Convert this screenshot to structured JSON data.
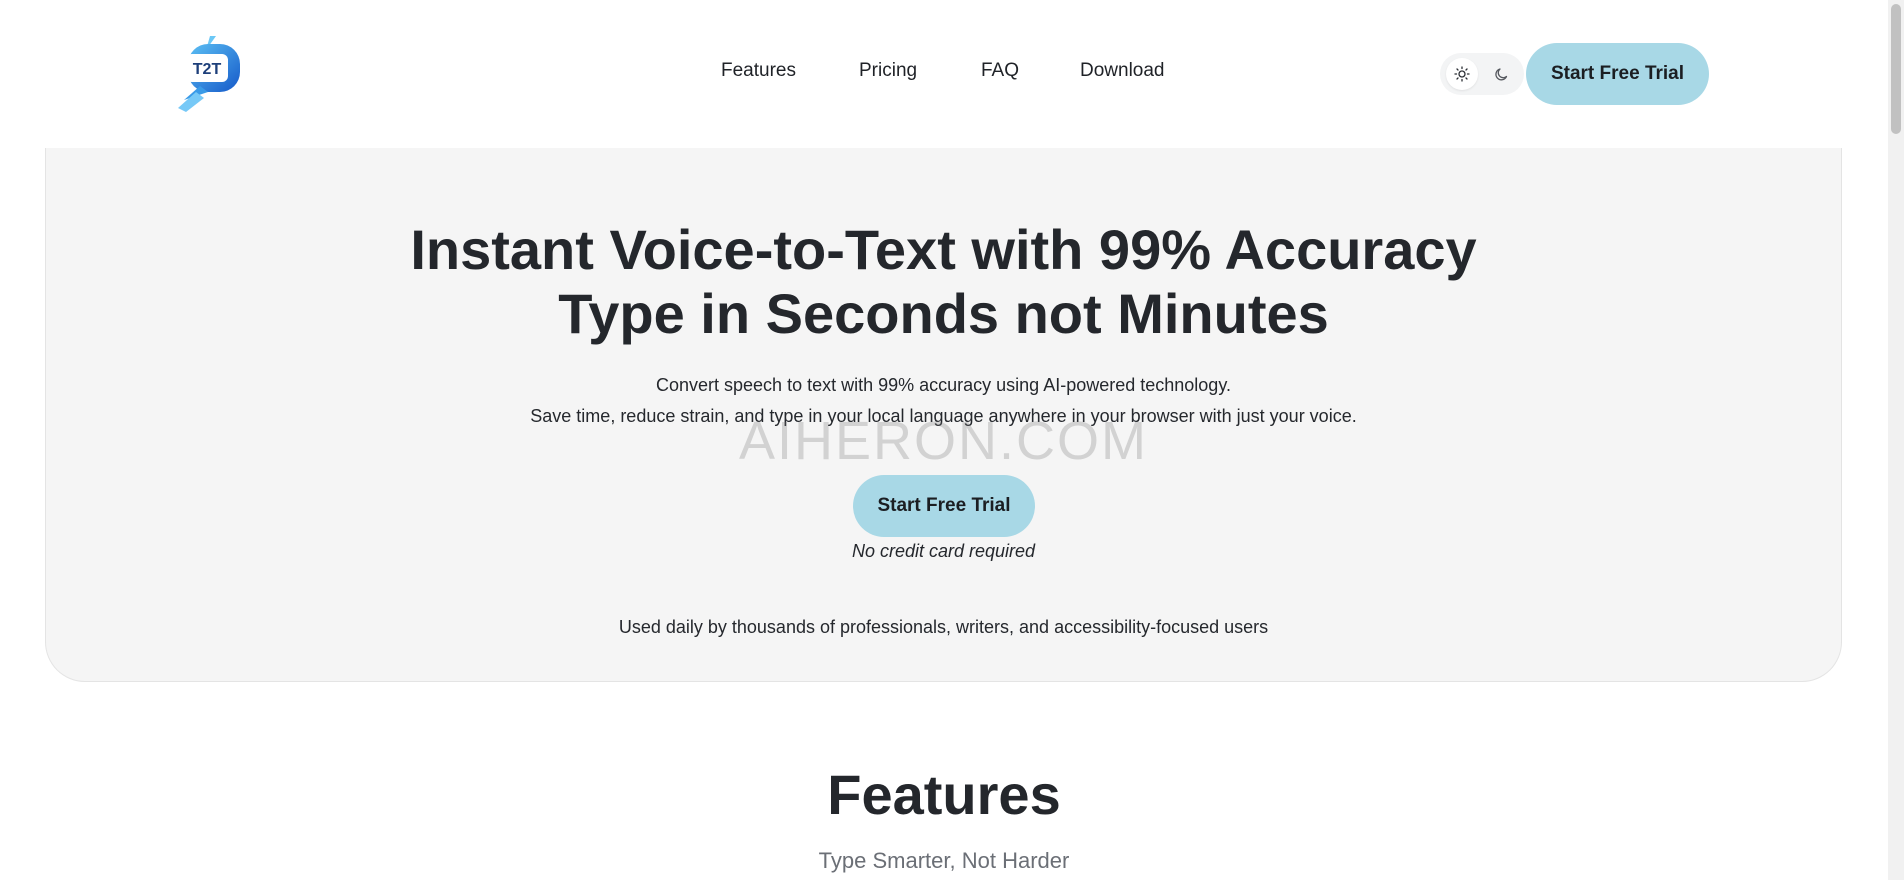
{
  "logo": {
    "text": "T2T"
  },
  "nav": [
    {
      "label": "Features"
    },
    {
      "label": "Pricing"
    },
    {
      "label": "FAQ"
    },
    {
      "label": "Download"
    }
  ],
  "theme_toggle": {
    "light_icon": "sun-icon",
    "dark_icon": "moon-icon"
  },
  "header_cta": "Start Free Trial",
  "hero": {
    "title_line1": "Instant Voice-to-Text with 99% Accuracy",
    "title_line2": "Type in Seconds not Minutes",
    "sub_line1": "Convert speech to text with 99% accuracy using AI-powered technology.",
    "sub_line2": "Save time, reduce strain, and type in your local language anywhere in your browser with just your voice.",
    "cta": "Start Free Trial",
    "note": "No credit card required",
    "social_proof": "Used daily by thousands of professionals, writers, and accessibility-focused users"
  },
  "watermark": "AIHERON.COM",
  "features": {
    "title": "Features",
    "subtitle": "Type Smarter, Not Harder"
  },
  "colors": {
    "accent": "#a8d8e6",
    "logo_blue": "#1e6fd9",
    "logo_light": "#4fb0f0",
    "hero_bg": "#f5f5f5",
    "text": "#24272c"
  }
}
